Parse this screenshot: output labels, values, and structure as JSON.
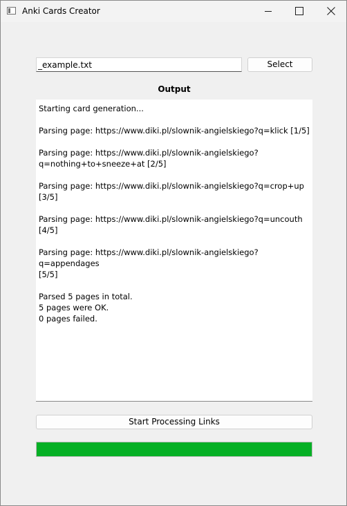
{
  "window": {
    "title": "Anki Cards Creator"
  },
  "file_field": {
    "value": "_example.txt"
  },
  "select_button": {
    "label": "Select"
  },
  "output": {
    "heading": "Output",
    "lines": [
      "Starting card generation...",
      "",
      "Parsing page: https://www.diki.pl/slownik-angielskiego?q=klick [1/5]",
      "",
      "Parsing page: https://www.diki.pl/slownik-angielskiego?",
      "q=nothing+to+sneeze+at [2/5]",
      "",
      "Parsing page: https://www.diki.pl/slownik-angielskiego?q=crop+up [3/5]",
      "",
      "Parsing page: https://www.diki.pl/slownik-angielskiego?q=uncouth [4/5]",
      "",
      "Parsing page: https://www.diki.pl/slownik-angielskiego?q=appendages",
      "[5/5]",
      "",
      "Parsed 5 pages in total.",
      "5 pages were OK.",
      "0 pages failed."
    ]
  },
  "start_button": {
    "label": "Start Processing Links"
  },
  "progress": {
    "value_percent": 100,
    "fill_color": "#06b025"
  },
  "icons": {
    "app": "app-window-icon",
    "minimize": "minimize-icon",
    "maximize": "maximize-icon",
    "close": "close-icon"
  }
}
